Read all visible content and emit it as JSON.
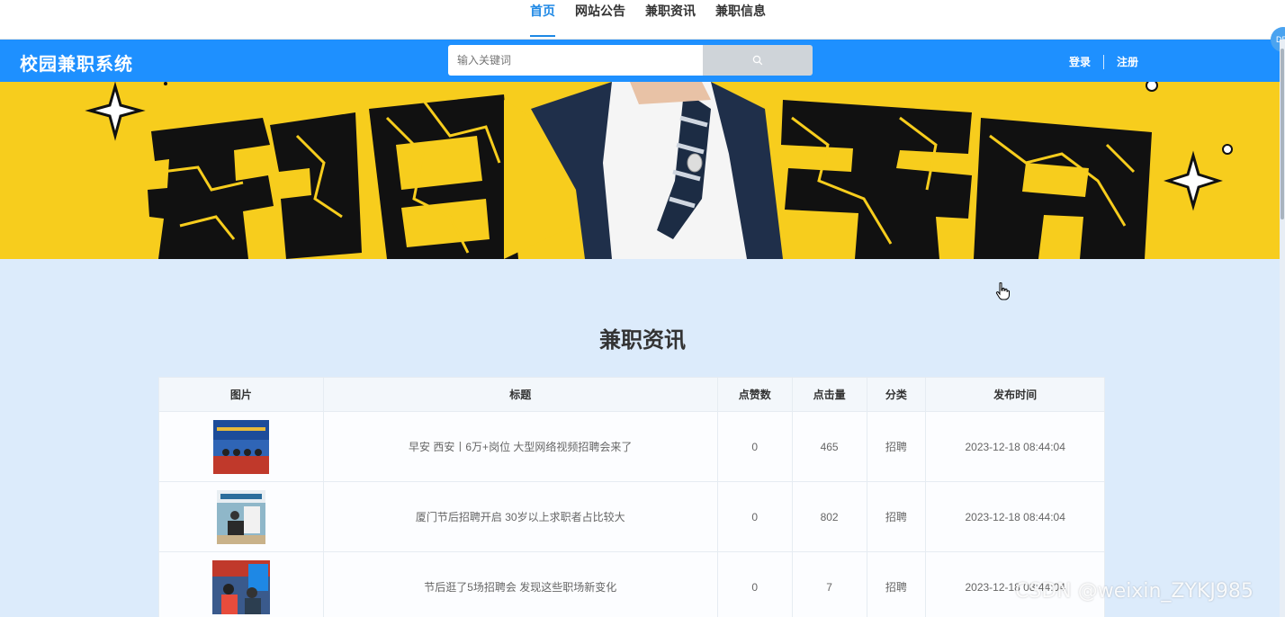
{
  "topnav": {
    "tabs": [
      {
        "label": "首页",
        "active": true
      },
      {
        "label": "网站公告",
        "active": false
      },
      {
        "label": "兼职资讯",
        "active": false
      },
      {
        "label": "兼职信息",
        "active": false
      }
    ]
  },
  "header": {
    "logo": "校园兼职系统",
    "search_placeholder": "输入关键词",
    "login_label": "登录",
    "register_label": "注册",
    "accent_color": "#1e90ff"
  },
  "corner_badge": "DE",
  "section": {
    "title": "兼职资讯"
  },
  "table": {
    "columns": [
      "图片",
      "标题",
      "点赞数",
      "点击量",
      "分类",
      "发布时间"
    ],
    "rows": [
      {
        "title": "早安 西安丨6万+岗位 大型网络视频招聘会来了",
        "likes": "0",
        "clicks": "465",
        "category": "招聘",
        "date": "2023-12-18 08:44:04"
      },
      {
        "title": "厦门节后招聘开启 30岁以上求职者占比较大",
        "likes": "0",
        "clicks": "802",
        "category": "招聘",
        "date": "2023-12-18 08:44:04"
      },
      {
        "title": "节后逛了5场招聘会 发现这些职场新变化",
        "likes": "0",
        "clicks": "7",
        "category": "招聘",
        "date": "2023-12-18 08:44:04"
      }
    ]
  },
  "watermark": "CSDN @weixin_ZYKJ985"
}
